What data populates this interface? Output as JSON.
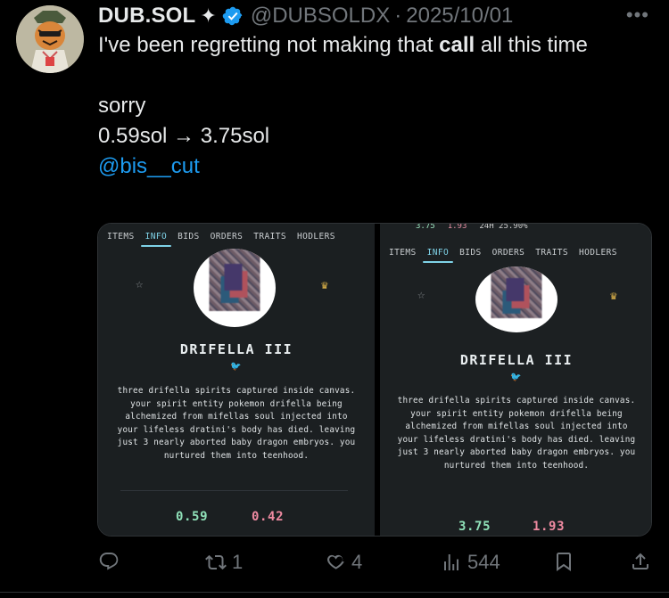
{
  "tweet": {
    "author_name": "DUB.SOL",
    "sparkle": "✦",
    "handle": "@DUBSOLDX",
    "separator": "·",
    "date": "2025/10/01",
    "more": "•••",
    "line1_pre": "I've been regretting not making that ",
    "line1_bold": "call",
    "line1_post": " all this time",
    "line2": "sorry",
    "line3": "0.59sol → 3.75sol",
    "mention": "@bis__cut"
  },
  "icons": {
    "avatar": "tiger-avatar",
    "verified": "verified-badge-icon",
    "reply": "reply-icon",
    "retweet": "retweet-icon",
    "like": "heart-icon",
    "views": "views-chart-icon",
    "bookmark": "bookmark-icon",
    "share": "share-icon"
  },
  "media": {
    "left": {
      "tabs": [
        "ITEMS",
        "INFO",
        "BIDS",
        "ORDERS",
        "TRAITS",
        "HODLERS"
      ],
      "active_tab": "INFO",
      "star": "☆",
      "crown": "♛",
      "title": "DRIFELLA III",
      "bird": "🐦",
      "description": "three drifella spirits captured inside canvas. your spirit entity pokemon drifella being alchemized from mifellas soul injected into your lifeless dratini's body has died. leaving just 3 nearly aborted baby dragon embryos. you nurtured them into teenhood.",
      "price_green": "0.59",
      "price_pink": "0.42"
    },
    "right": {
      "top_strip": [
        "3.75",
        "1.93",
        "24H 25.90%"
      ],
      "tabs": [
        "ITEMS",
        "INFO",
        "BIDS",
        "ORDERS",
        "TRAITS",
        "HODLERS"
      ],
      "active_tab": "INFO",
      "star": "☆",
      "crown": "♛",
      "title": "DRIFELLA III",
      "bird": "🐦",
      "description": "three drifella spirits captured inside canvas. your spirit entity pokemon drifella being alchemized from mifellas soul injected into your lifeless dratini's body has died. leaving just 3 nearly aborted baby dragon embryos. you nurtured them into teenhood.",
      "price_green": "3.75",
      "price_pink": "1.93"
    }
  },
  "actions": {
    "retweets": "1",
    "likes": "4",
    "views": "544"
  },
  "colors": {
    "background": "#000000",
    "text": "#e7e9ea",
    "muted": "#71767b",
    "link": "#1d9bf0",
    "verified": "#1d9bf0",
    "price_green": "#8fe0b8",
    "price_pink": "#ef8aa1",
    "tab_active": "#7fd3e8"
  }
}
